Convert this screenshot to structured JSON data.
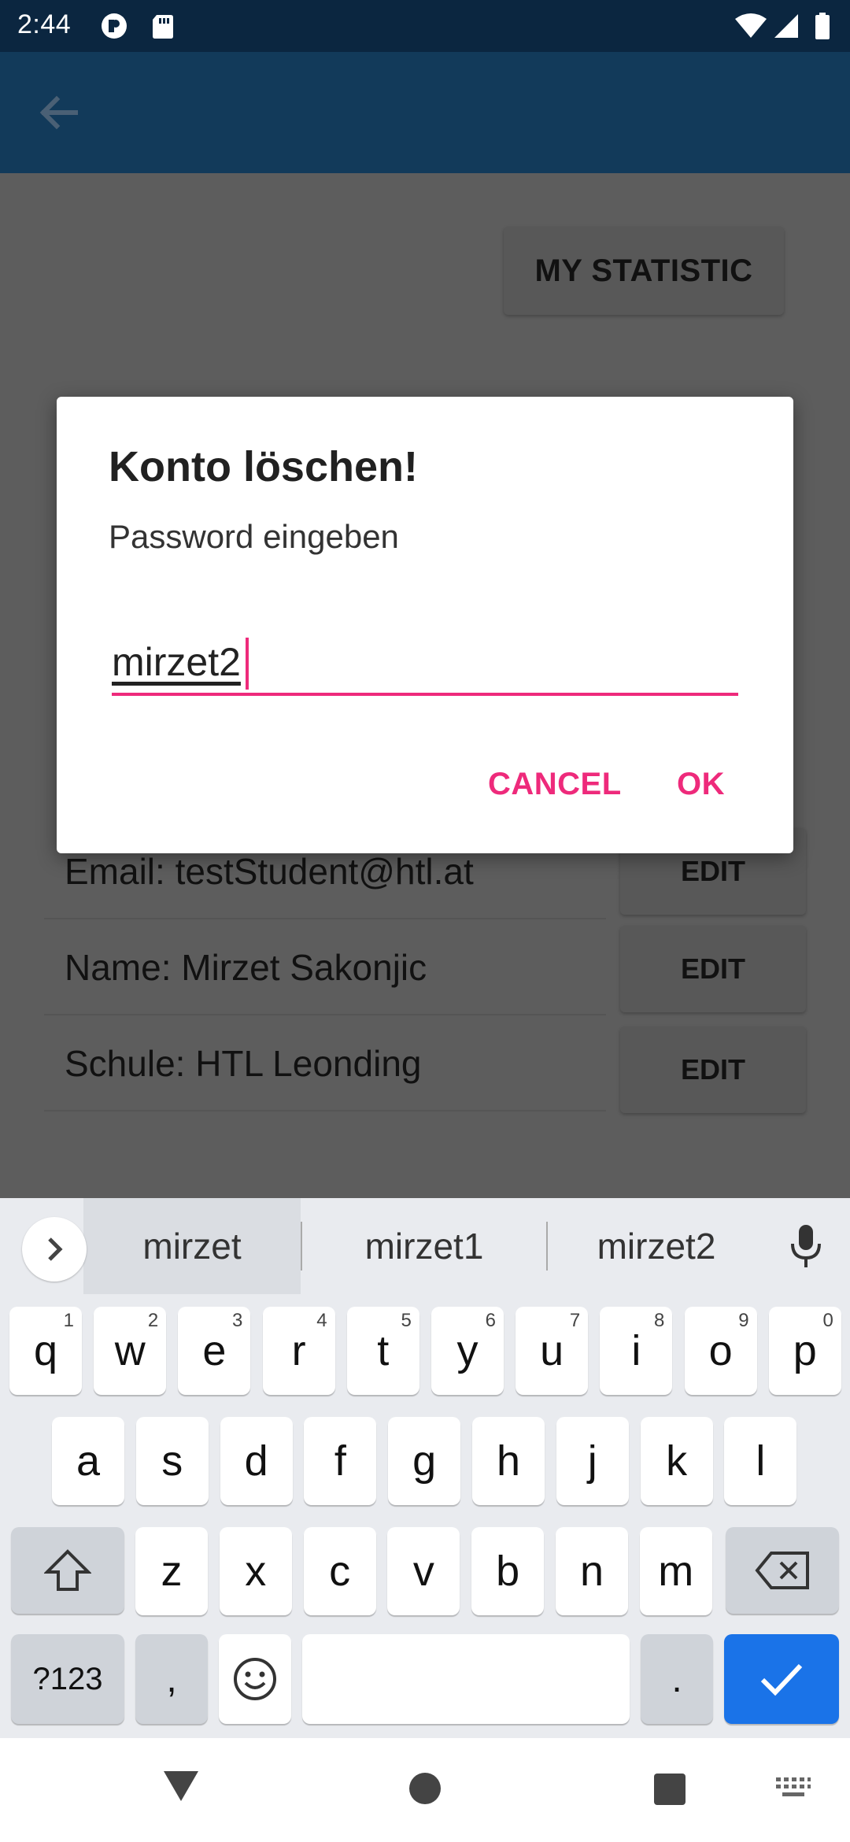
{
  "status_bar": {
    "time": "2:44",
    "icons": [
      "notification-icon",
      "sd-card-icon",
      "wifi-icon",
      "signal-icon",
      "battery-icon"
    ]
  },
  "app_bar": {
    "back_icon": "arrow-left-icon"
  },
  "page": {
    "statistic_button": "MY STATISTIC",
    "rows": [
      {
        "label": "Email: testStudent@htl.at",
        "edit": "EDIT"
      },
      {
        "label": "Name: Mirzet Sakonjic",
        "edit": "EDIT"
      },
      {
        "label": "Schule: HTL Leonding",
        "edit": "EDIT"
      }
    ]
  },
  "dialog": {
    "title": "Konto löschen!",
    "message": "Password eingeben",
    "input_value": "mirzet2",
    "cancel": "CANCEL",
    "ok": "OK",
    "accent_color": "#ee2a7b"
  },
  "keyboard": {
    "suggestions": [
      "mirzet",
      "mirzet1",
      "mirzet2"
    ],
    "row1": [
      {
        "k": "q",
        "h": "1"
      },
      {
        "k": "w",
        "h": "2"
      },
      {
        "k": "e",
        "h": "3"
      },
      {
        "k": "r",
        "h": "4"
      },
      {
        "k": "t",
        "h": "5"
      },
      {
        "k": "y",
        "h": "6"
      },
      {
        "k": "u",
        "h": "7"
      },
      {
        "k": "i",
        "h": "8"
      },
      {
        "k": "o",
        "h": "9"
      },
      {
        "k": "p",
        "h": "0"
      }
    ],
    "row2": [
      "a",
      "s",
      "d",
      "f",
      "g",
      "h",
      "j",
      "k",
      "l"
    ],
    "row3": [
      "z",
      "x",
      "c",
      "v",
      "b",
      "n",
      "m"
    ],
    "symbols_key": "?123",
    "comma_key": ",",
    "period_key": ".",
    "enter_color": "#1a73e8"
  },
  "nav_bar": {
    "icons": [
      "back-triangle-icon",
      "home-circle-icon",
      "recents-square-icon",
      "keyboard-switch-icon"
    ]
  }
}
